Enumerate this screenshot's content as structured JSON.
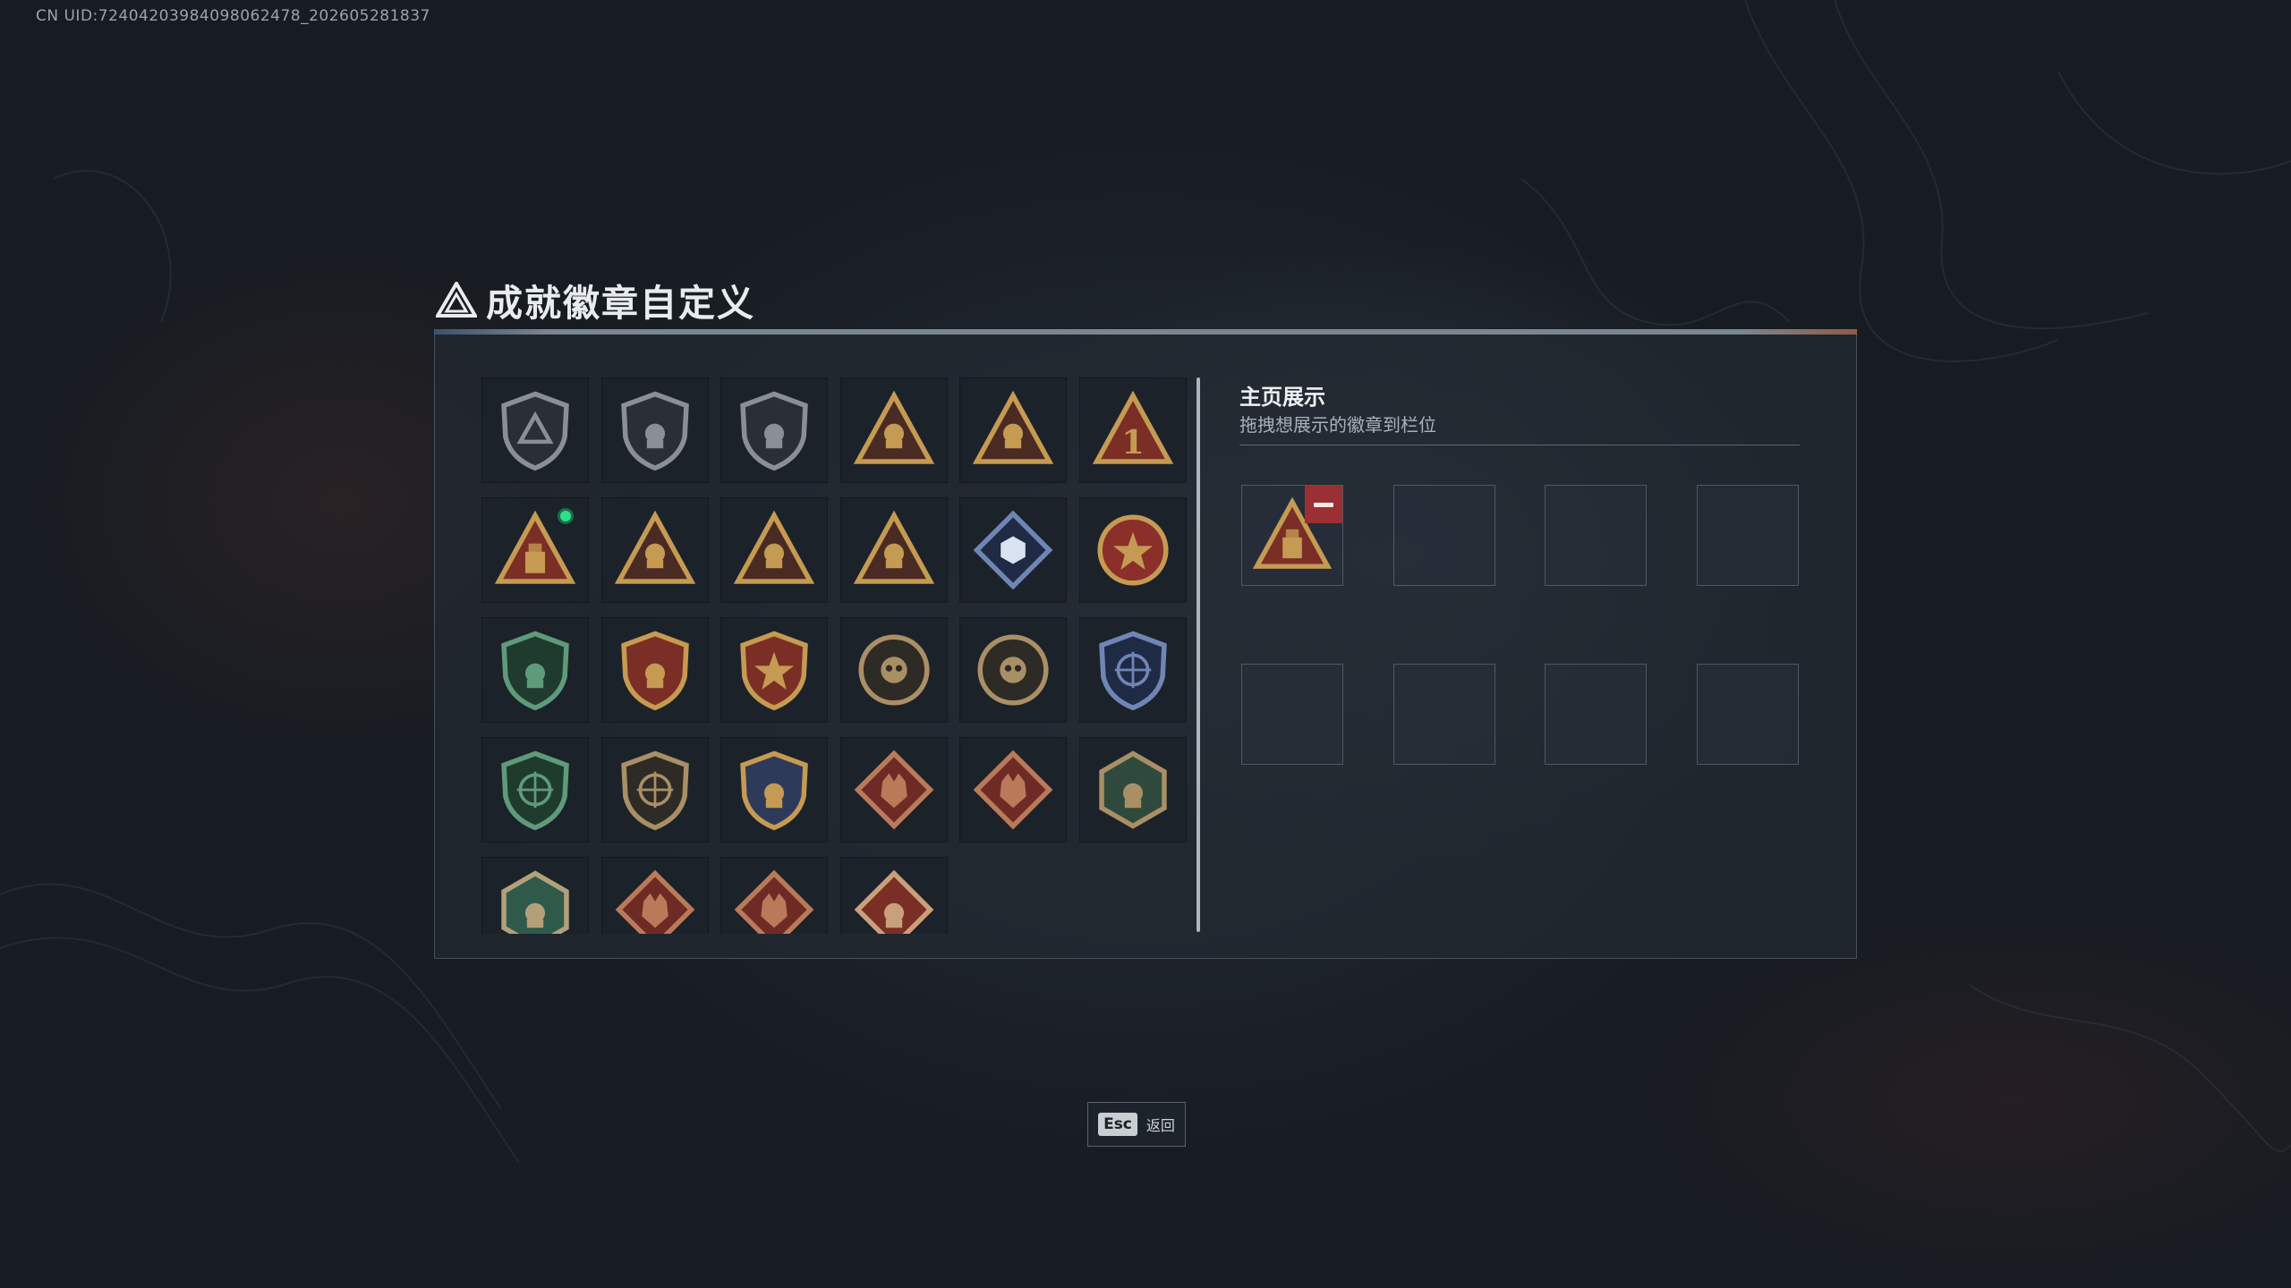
{
  "uid_text": "CN UID:7240420398409806​2478_202605281837",
  "page": {
    "title": "成就徽章自定义",
    "title_icon": "triangle-logo-icon"
  },
  "badges": [
    {
      "name": "badge-shield-triangle",
      "shape": "shield",
      "color": "#8a8f95",
      "accent": "#2a2f35",
      "glyph": "tri"
    },
    {
      "name": "badge-shield-helicopter",
      "shape": "shield",
      "color": "#8a8f95",
      "accent": "#2a2f35",
      "glyph": "heli"
    },
    {
      "name": "badge-shield-blades",
      "shape": "shield",
      "color": "#8a8f95",
      "accent": "#2a2f35",
      "glyph": "blade"
    },
    {
      "name": "badge-triangle-armor",
      "shape": "triangle",
      "color": "#c59a52",
      "accent": "#4a2b24",
      "glyph": "armor"
    },
    {
      "name": "badge-triangle-boat",
      "shape": "triangle",
      "color": "#c59a52",
      "accent": "#4a2b24",
      "glyph": "boat"
    },
    {
      "name": "badge-triangle-one",
      "shape": "triangle",
      "color": "#c59a52",
      "accent": "#7a2e25",
      "glyph": "one"
    },
    {
      "name": "badge-triangle-crate",
      "shape": "triangle",
      "color": "#c59a52",
      "accent": "#7a2e25",
      "glyph": "crate",
      "new": true
    },
    {
      "name": "badge-triangle-heart",
      "shape": "triangle",
      "color": "#c59a52",
      "accent": "#4a2b24",
      "glyph": "heart"
    },
    {
      "name": "badge-triangle-squad",
      "shape": "triangle",
      "color": "#c59a52",
      "accent": "#4a2b24",
      "glyph": "squad"
    },
    {
      "name": "badge-triangle-rocket",
      "shape": "triangle",
      "color": "#c59a52",
      "accent": "#4a2b24",
      "glyph": "rocket"
    },
    {
      "name": "badge-diamond-cube",
      "shape": "diamond",
      "color": "#6f86b5",
      "accent": "#1f2a44",
      "glyph": "cube"
    },
    {
      "name": "badge-star-medal",
      "shape": "round",
      "color": "#c59a52",
      "accent": "#8a2f2a",
      "glyph": "star"
    },
    {
      "name": "badge-green-shield-emblem",
      "shape": "shield",
      "color": "#5f9a7a",
      "accent": "#1f3b2e",
      "glyph": "emblem"
    },
    {
      "name": "badge-red-crest-wrench",
      "shape": "shield",
      "color": "#c59a52",
      "accent": "#7a2e25",
      "glyph": "wrench"
    },
    {
      "name": "badge-red-crest-star",
      "shape": "shield",
      "color": "#c59a52",
      "accent": "#7a2e25",
      "glyph": "star"
    },
    {
      "name": "badge-round-skull",
      "shape": "round",
      "color": "#a88f66",
      "accent": "#2e2a26",
      "glyph": "skull"
    },
    {
      "name": "badge-round-gear",
      "shape": "round",
      "color": "#a88f66",
      "accent": "#2e2a26",
      "glyph": "gear"
    },
    {
      "name": "badge-blue-shield-target",
      "shape": "shield",
      "color": "#6f86b5",
      "accent": "#1f2a44",
      "glyph": "target"
    },
    {
      "name": "badge-green-shield-target",
      "shape": "shield",
      "color": "#5f9a7a",
      "accent": "#1f3b2e",
      "glyph": "target"
    },
    {
      "name": "badge-round-scope",
      "shape": "shield",
      "color": "#a88f66",
      "accent": "#2e2a26",
      "glyph": "scope"
    },
    {
      "name": "badge-gold-shield-tools",
      "shape": "shield",
      "color": "#c59a52",
      "accent": "#2e3a5a",
      "glyph": "tools"
    },
    {
      "name": "badge-diamond-wolf",
      "shape": "diamond",
      "color": "#b97a5a",
      "accent": "#6e2a25",
      "glyph": "wolf"
    },
    {
      "name": "badge-diamond-wolf-2",
      "shape": "diamond",
      "color": "#b97a5a",
      "accent": "#6e2a25",
      "glyph": "wolf"
    },
    {
      "name": "badge-hex-eagle",
      "shape": "hex",
      "color": "#a88f66",
      "accent": "#2f4a3c",
      "glyph": "eagle"
    },
    {
      "name": "badge-hex-gun",
      "shape": "hex",
      "color": "#b3a07a",
      "accent": "#2f5a4a",
      "glyph": "gun"
    },
    {
      "name": "badge-diamond-dragon",
      "shape": "diamond",
      "color": "#b97a5a",
      "accent": "#6e2a25",
      "glyph": "dragon"
    },
    {
      "name": "badge-diamond-dragon-2",
      "shape": "diamond",
      "color": "#b97a5a",
      "accent": "#6e2a25",
      "glyph": "dragon"
    },
    {
      "name": "badge-diamond-runner",
      "shape": "diamond",
      "color": "#c9a07a",
      "accent": "#7a2e25",
      "glyph": "runner"
    }
  ],
  "showcase": {
    "title": "主页展示",
    "subtitle": "拖拽想展示的徽章到栏位",
    "slots": [
      {
        "filled": true,
        "badge": "badge-triangle-crate"
      },
      {
        "filled": false
      },
      {
        "filled": false
      },
      {
        "filled": false
      },
      {
        "filled": false
      },
      {
        "filled": false
      },
      {
        "filled": false
      },
      {
        "filled": false
      }
    ]
  },
  "footer": {
    "key": "Esc",
    "label": "返回"
  },
  "colors": {
    "new_indicator": "#2fe08a",
    "remove_button": "#9b2f33"
  }
}
